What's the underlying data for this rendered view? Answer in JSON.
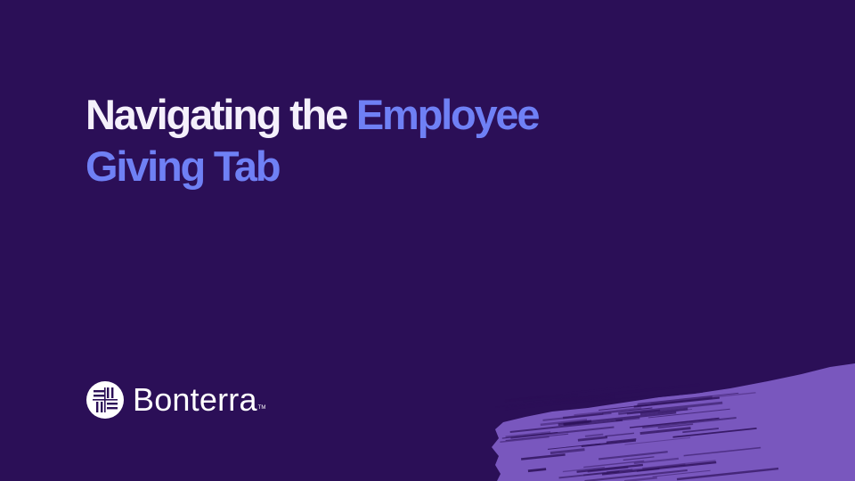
{
  "slide": {
    "title_part1": "Navigating the ",
    "title_accent_line1": "Employee",
    "title_accent_line2": "Giving Tab"
  },
  "logo": {
    "wordmark": "Bonterra",
    "trademark": "TM",
    "icon": "woven-square-logo-icon"
  },
  "colors": {
    "background": "#2b0f57",
    "title_text": "#f4f0fb",
    "accent": "#6f80f5",
    "brush": "#7d5cc4"
  }
}
